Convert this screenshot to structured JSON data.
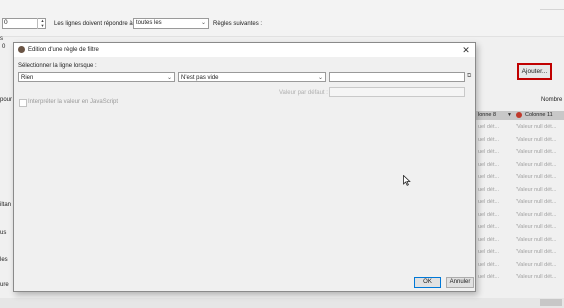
{
  "background": {
    "spin_value": "0",
    "rows_label": "Les lignes doivent répondre à",
    "rows_select_value": "toutes les",
    "rules_label": "Règles suivantes :",
    "edge_text": "s",
    "number_zero": "0",
    "add_button_label": "Ajouter...",
    "nombre_label": "Nombre",
    "side_words": [
      "pour la",
      "iltan",
      "us",
      "les",
      "ure"
    ],
    "table": {
      "col1_header": "lonne 8",
      "col2_header": "Colonne 11",
      "col1_cells": [
        "uel dét...",
        "uel dét...",
        "uel dét...",
        "uel dét...",
        "uel dét...",
        "uel dét...",
        "uel dét...",
        "uel dét...",
        "uel dét...",
        "uel dét...",
        "uel dét...",
        "uel dét...",
        "uel dét..."
      ],
      "col2_cells": [
        "'Valeur null dét...",
        "'Valeur null dét...",
        "'Valeur null dét...",
        "'Valeur null dét...",
        "'Valeur null dét...",
        "'Valeur null dét...",
        "'Valeur null dét...",
        "'Valeur null dét...",
        "'Valeur null dét...",
        "'Valeur null dét...",
        "'Valeur null dét...",
        "'Valeur null dét...",
        "'Valeur null dét..."
      ]
    }
  },
  "dialog": {
    "title": "Edition d'une règle de filtre",
    "close_glyph": "✕",
    "select_line_label": "Sélectionner la ligne lorsque :",
    "field_combo_value": "Rien",
    "operator_combo_value": "N'est pas vide",
    "value_input": "",
    "default_value_label": "Valeur par défaut :",
    "default_value_input": "",
    "js_checkbox_label": "Interpréter la valeur en JavaScript",
    "ok_label": "OK",
    "cancel_label": "Annuler"
  },
  "colors": {
    "highlight_border": "#c00000",
    "ok_border": "#0078d7",
    "column_dot": "#c0392b"
  }
}
